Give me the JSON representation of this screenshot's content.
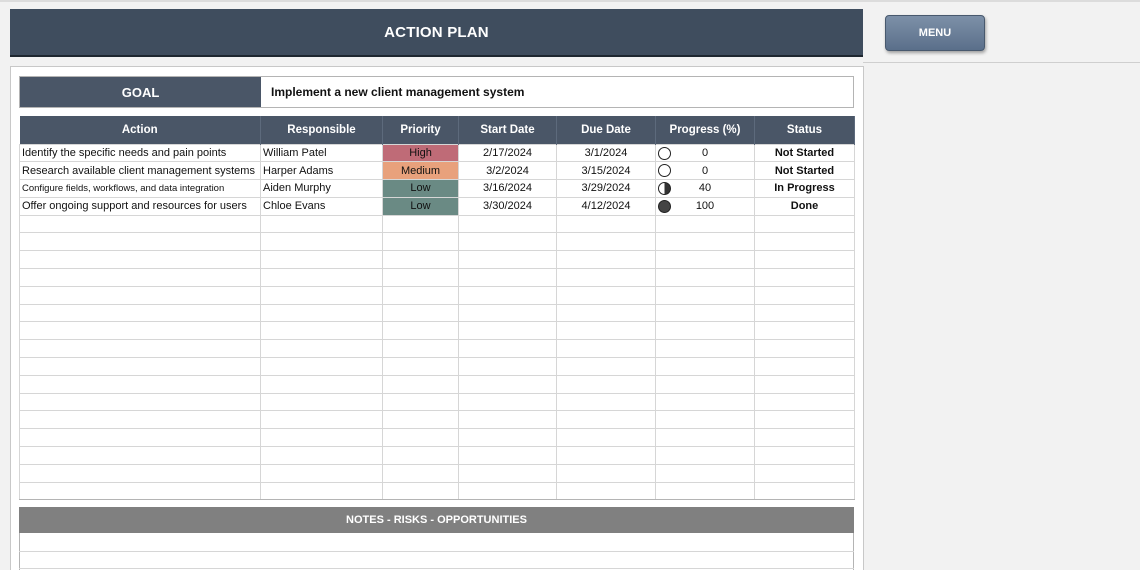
{
  "title": "ACTION PLAN",
  "menu_label": "MENU",
  "goal": {
    "label": "GOAL",
    "text": "Implement a new client management system"
  },
  "table": {
    "columns": [
      "Action",
      "Responsible",
      "Priority",
      "Start Date",
      "Due Date",
      "Progress (%)",
      "Status"
    ],
    "rows": [
      {
        "action": "Identify the specific needs and pain points",
        "responsible": "William Patel",
        "priority": "High",
        "start": "2/17/2024",
        "due": "3/1/2024",
        "progress": "0",
        "status": "Not Started"
      },
      {
        "action": "Research available client management systems",
        "responsible": "Harper Adams",
        "priority": "Medium",
        "start": "3/2/2024",
        "due": "3/15/2024",
        "progress": "0",
        "status": "Not Started"
      },
      {
        "action": "Configure fields, workflows, and data integration",
        "responsible": "Aiden Murphy",
        "priority": "Low",
        "start": "3/16/2024",
        "due": "3/29/2024",
        "progress": "40",
        "status": "In Progress"
      },
      {
        "action": "Offer ongoing support and resources for users",
        "responsible": "Chloe Evans",
        "priority": "Low",
        "start": "3/30/2024",
        "due": "4/12/2024",
        "progress": "100",
        "status": "Done"
      }
    ]
  },
  "notes_header": "NOTES - RISKS - OPPORTUNITIES",
  "colors": {
    "header_bg": "#4a5667",
    "priority_high": "#bf6b77",
    "priority_medium": "#e8a17c",
    "priority_low": "#6a8a84",
    "status_text": "#23408e"
  }
}
